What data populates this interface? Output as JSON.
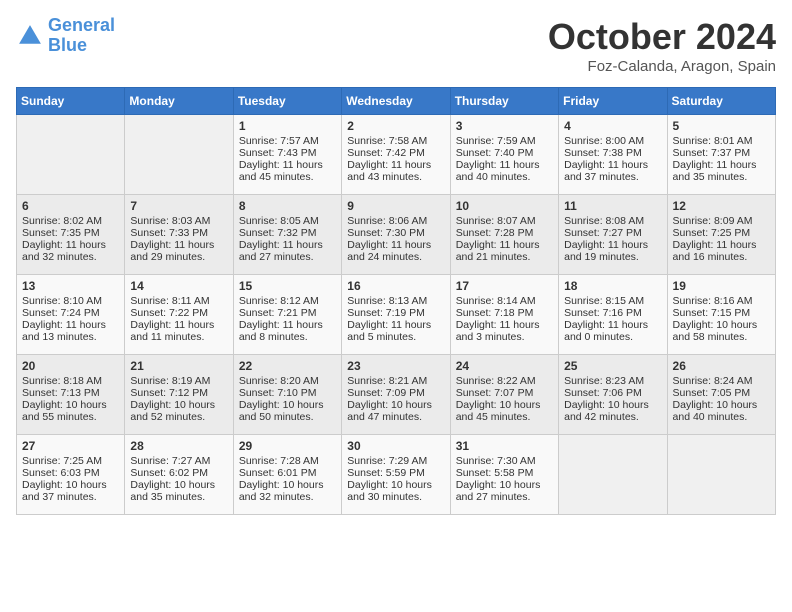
{
  "logo": {
    "text_general": "General",
    "text_blue": "Blue"
  },
  "header": {
    "month": "October 2024",
    "location": "Foz-Calanda, Aragon, Spain"
  },
  "days_of_week": [
    "Sunday",
    "Monday",
    "Tuesday",
    "Wednesday",
    "Thursday",
    "Friday",
    "Saturday"
  ],
  "weeks": [
    [
      {
        "day": "",
        "sunrise": "",
        "sunset": "",
        "daylight": ""
      },
      {
        "day": "",
        "sunrise": "",
        "sunset": "",
        "daylight": ""
      },
      {
        "day": "1",
        "sunrise": "Sunrise: 7:57 AM",
        "sunset": "Sunset: 7:43 PM",
        "daylight": "Daylight: 11 hours and 45 minutes."
      },
      {
        "day": "2",
        "sunrise": "Sunrise: 7:58 AM",
        "sunset": "Sunset: 7:42 PM",
        "daylight": "Daylight: 11 hours and 43 minutes."
      },
      {
        "day": "3",
        "sunrise": "Sunrise: 7:59 AM",
        "sunset": "Sunset: 7:40 PM",
        "daylight": "Daylight: 11 hours and 40 minutes."
      },
      {
        "day": "4",
        "sunrise": "Sunrise: 8:00 AM",
        "sunset": "Sunset: 7:38 PM",
        "daylight": "Daylight: 11 hours and 37 minutes."
      },
      {
        "day": "5",
        "sunrise": "Sunrise: 8:01 AM",
        "sunset": "Sunset: 7:37 PM",
        "daylight": "Daylight: 11 hours and 35 minutes."
      }
    ],
    [
      {
        "day": "6",
        "sunrise": "Sunrise: 8:02 AM",
        "sunset": "Sunset: 7:35 PM",
        "daylight": "Daylight: 11 hours and 32 minutes."
      },
      {
        "day": "7",
        "sunrise": "Sunrise: 8:03 AM",
        "sunset": "Sunset: 7:33 PM",
        "daylight": "Daylight: 11 hours and 29 minutes."
      },
      {
        "day": "8",
        "sunrise": "Sunrise: 8:05 AM",
        "sunset": "Sunset: 7:32 PM",
        "daylight": "Daylight: 11 hours and 27 minutes."
      },
      {
        "day": "9",
        "sunrise": "Sunrise: 8:06 AM",
        "sunset": "Sunset: 7:30 PM",
        "daylight": "Daylight: 11 hours and 24 minutes."
      },
      {
        "day": "10",
        "sunrise": "Sunrise: 8:07 AM",
        "sunset": "Sunset: 7:28 PM",
        "daylight": "Daylight: 11 hours and 21 minutes."
      },
      {
        "day": "11",
        "sunrise": "Sunrise: 8:08 AM",
        "sunset": "Sunset: 7:27 PM",
        "daylight": "Daylight: 11 hours and 19 minutes."
      },
      {
        "day": "12",
        "sunrise": "Sunrise: 8:09 AM",
        "sunset": "Sunset: 7:25 PM",
        "daylight": "Daylight: 11 hours and 16 minutes."
      }
    ],
    [
      {
        "day": "13",
        "sunrise": "Sunrise: 8:10 AM",
        "sunset": "Sunset: 7:24 PM",
        "daylight": "Daylight: 11 hours and 13 minutes."
      },
      {
        "day": "14",
        "sunrise": "Sunrise: 8:11 AM",
        "sunset": "Sunset: 7:22 PM",
        "daylight": "Daylight: 11 hours and 11 minutes."
      },
      {
        "day": "15",
        "sunrise": "Sunrise: 8:12 AM",
        "sunset": "Sunset: 7:21 PM",
        "daylight": "Daylight: 11 hours and 8 minutes."
      },
      {
        "day": "16",
        "sunrise": "Sunrise: 8:13 AM",
        "sunset": "Sunset: 7:19 PM",
        "daylight": "Daylight: 11 hours and 5 minutes."
      },
      {
        "day": "17",
        "sunrise": "Sunrise: 8:14 AM",
        "sunset": "Sunset: 7:18 PM",
        "daylight": "Daylight: 11 hours and 3 minutes."
      },
      {
        "day": "18",
        "sunrise": "Sunrise: 8:15 AM",
        "sunset": "Sunset: 7:16 PM",
        "daylight": "Daylight: 11 hours and 0 minutes."
      },
      {
        "day": "19",
        "sunrise": "Sunrise: 8:16 AM",
        "sunset": "Sunset: 7:15 PM",
        "daylight": "Daylight: 10 hours and 58 minutes."
      }
    ],
    [
      {
        "day": "20",
        "sunrise": "Sunrise: 8:18 AM",
        "sunset": "Sunset: 7:13 PM",
        "daylight": "Daylight: 10 hours and 55 minutes."
      },
      {
        "day": "21",
        "sunrise": "Sunrise: 8:19 AM",
        "sunset": "Sunset: 7:12 PM",
        "daylight": "Daylight: 10 hours and 52 minutes."
      },
      {
        "day": "22",
        "sunrise": "Sunrise: 8:20 AM",
        "sunset": "Sunset: 7:10 PM",
        "daylight": "Daylight: 10 hours and 50 minutes."
      },
      {
        "day": "23",
        "sunrise": "Sunrise: 8:21 AM",
        "sunset": "Sunset: 7:09 PM",
        "daylight": "Daylight: 10 hours and 47 minutes."
      },
      {
        "day": "24",
        "sunrise": "Sunrise: 8:22 AM",
        "sunset": "Sunset: 7:07 PM",
        "daylight": "Daylight: 10 hours and 45 minutes."
      },
      {
        "day": "25",
        "sunrise": "Sunrise: 8:23 AM",
        "sunset": "Sunset: 7:06 PM",
        "daylight": "Daylight: 10 hours and 42 minutes."
      },
      {
        "day": "26",
        "sunrise": "Sunrise: 8:24 AM",
        "sunset": "Sunset: 7:05 PM",
        "daylight": "Daylight: 10 hours and 40 minutes."
      }
    ],
    [
      {
        "day": "27",
        "sunrise": "Sunrise: 7:25 AM",
        "sunset": "Sunset: 6:03 PM",
        "daylight": "Daylight: 10 hours and 37 minutes."
      },
      {
        "day": "28",
        "sunrise": "Sunrise: 7:27 AM",
        "sunset": "Sunset: 6:02 PM",
        "daylight": "Daylight: 10 hours and 35 minutes."
      },
      {
        "day": "29",
        "sunrise": "Sunrise: 7:28 AM",
        "sunset": "Sunset: 6:01 PM",
        "daylight": "Daylight: 10 hours and 32 minutes."
      },
      {
        "day": "30",
        "sunrise": "Sunrise: 7:29 AM",
        "sunset": "Sunset: 5:59 PM",
        "daylight": "Daylight: 10 hours and 30 minutes."
      },
      {
        "day": "31",
        "sunrise": "Sunrise: 7:30 AM",
        "sunset": "Sunset: 5:58 PM",
        "daylight": "Daylight: 10 hours and 27 minutes."
      },
      {
        "day": "",
        "sunrise": "",
        "sunset": "",
        "daylight": ""
      },
      {
        "day": "",
        "sunrise": "",
        "sunset": "",
        "daylight": ""
      }
    ]
  ]
}
